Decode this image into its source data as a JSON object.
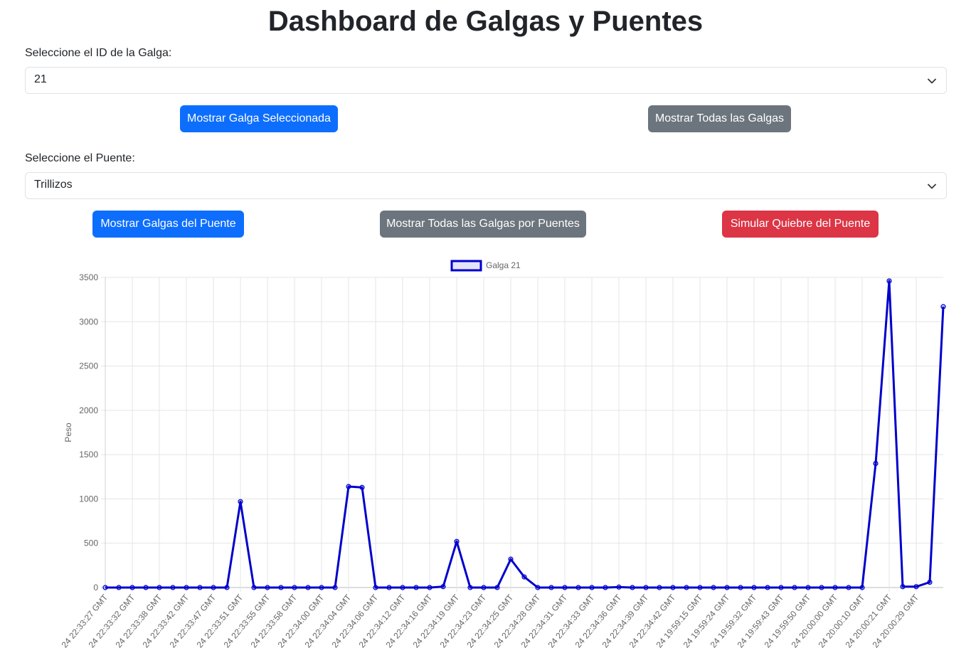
{
  "page": {
    "title": "Dashboard de Galgas y Puentes"
  },
  "galga": {
    "label": "Seleccione el ID de la Galga:",
    "selected": "21",
    "show_selected_button": "Mostrar Galga Seleccionada",
    "show_all_button": "Mostrar Todas las Galgas"
  },
  "puente": {
    "label": "Seleccione el Puente:",
    "selected": "Trillizos",
    "show_bridge_button": "Mostrar Galgas del Puente",
    "show_all_by_bridge_button": "Mostrar Todas las Galgas por Puentes",
    "simulate_break_button": "Simular Quiebre del Puente"
  },
  "colors": {
    "primary": "#0d6efd",
    "secondary": "#6c757d",
    "danger": "#dc3545",
    "series": "#0000cc"
  },
  "chart_data": {
    "type": "line",
    "ylabel": "Peso",
    "xlabel": "",
    "ylim": [
      0,
      3500
    ],
    "yticks": [
      0,
      500,
      1000,
      1500,
      2000,
      2500,
      3000,
      3500
    ],
    "grid": true,
    "legend": "top-center",
    "series": [
      {
        "name": "Galga 21",
        "values": [
          0,
          0,
          0,
          0,
          0,
          0,
          0,
          0,
          0,
          0,
          970,
          0,
          0,
          0,
          0,
          0,
          0,
          0,
          1140,
          1130,
          0,
          0,
          0,
          0,
          0,
          10,
          520,
          0,
          0,
          0,
          320,
          120,
          0,
          0,
          0,
          0,
          0,
          0,
          5,
          0,
          0,
          0,
          0,
          0,
          0,
          0,
          0,
          0,
          0,
          0,
          0,
          0,
          0,
          0,
          0,
          0,
          0,
          1400,
          3460,
          10,
          10,
          60,
          3170
        ]
      }
    ],
    "x_tick_labels": [
      "24 22:33:27 GMT",
      "24 22:33:32 GMT",
      "24 22:33:38 GMT",
      "24 22:33:42 GMT",
      "24 22:33:47 GMT",
      "24 22:33:51 GMT",
      "24 22:33:55 GMT",
      "24 22:33:58 GMT",
      "24 22:34:00 GMT",
      "24 22:34:04 GMT",
      "24 22:34:06 GMT",
      "24 22:34:12 GMT",
      "24 22:34:16 GMT",
      "24 22:34:19 GMT",
      "24 22:34:23 GMT",
      "24 22:34:25 GMT",
      "24 22:34:28 GMT",
      "24 22:34:31 GMT",
      "24 22:34:33 GMT",
      "24 22:34:36 GMT",
      "24 22:34:39 GMT",
      "24 22:34:42 GMT",
      "24 19:59:15 GMT",
      "24 19:59:24 GMT",
      "24 19:59:32 GMT",
      "24 19:59:43 GMT",
      "24 19:59:50 GMT",
      "24 20:00:00 GMT",
      "24 20:00:10 GMT",
      "24 20:00:21 GMT",
      "24 20:00:29 GMT"
    ]
  }
}
